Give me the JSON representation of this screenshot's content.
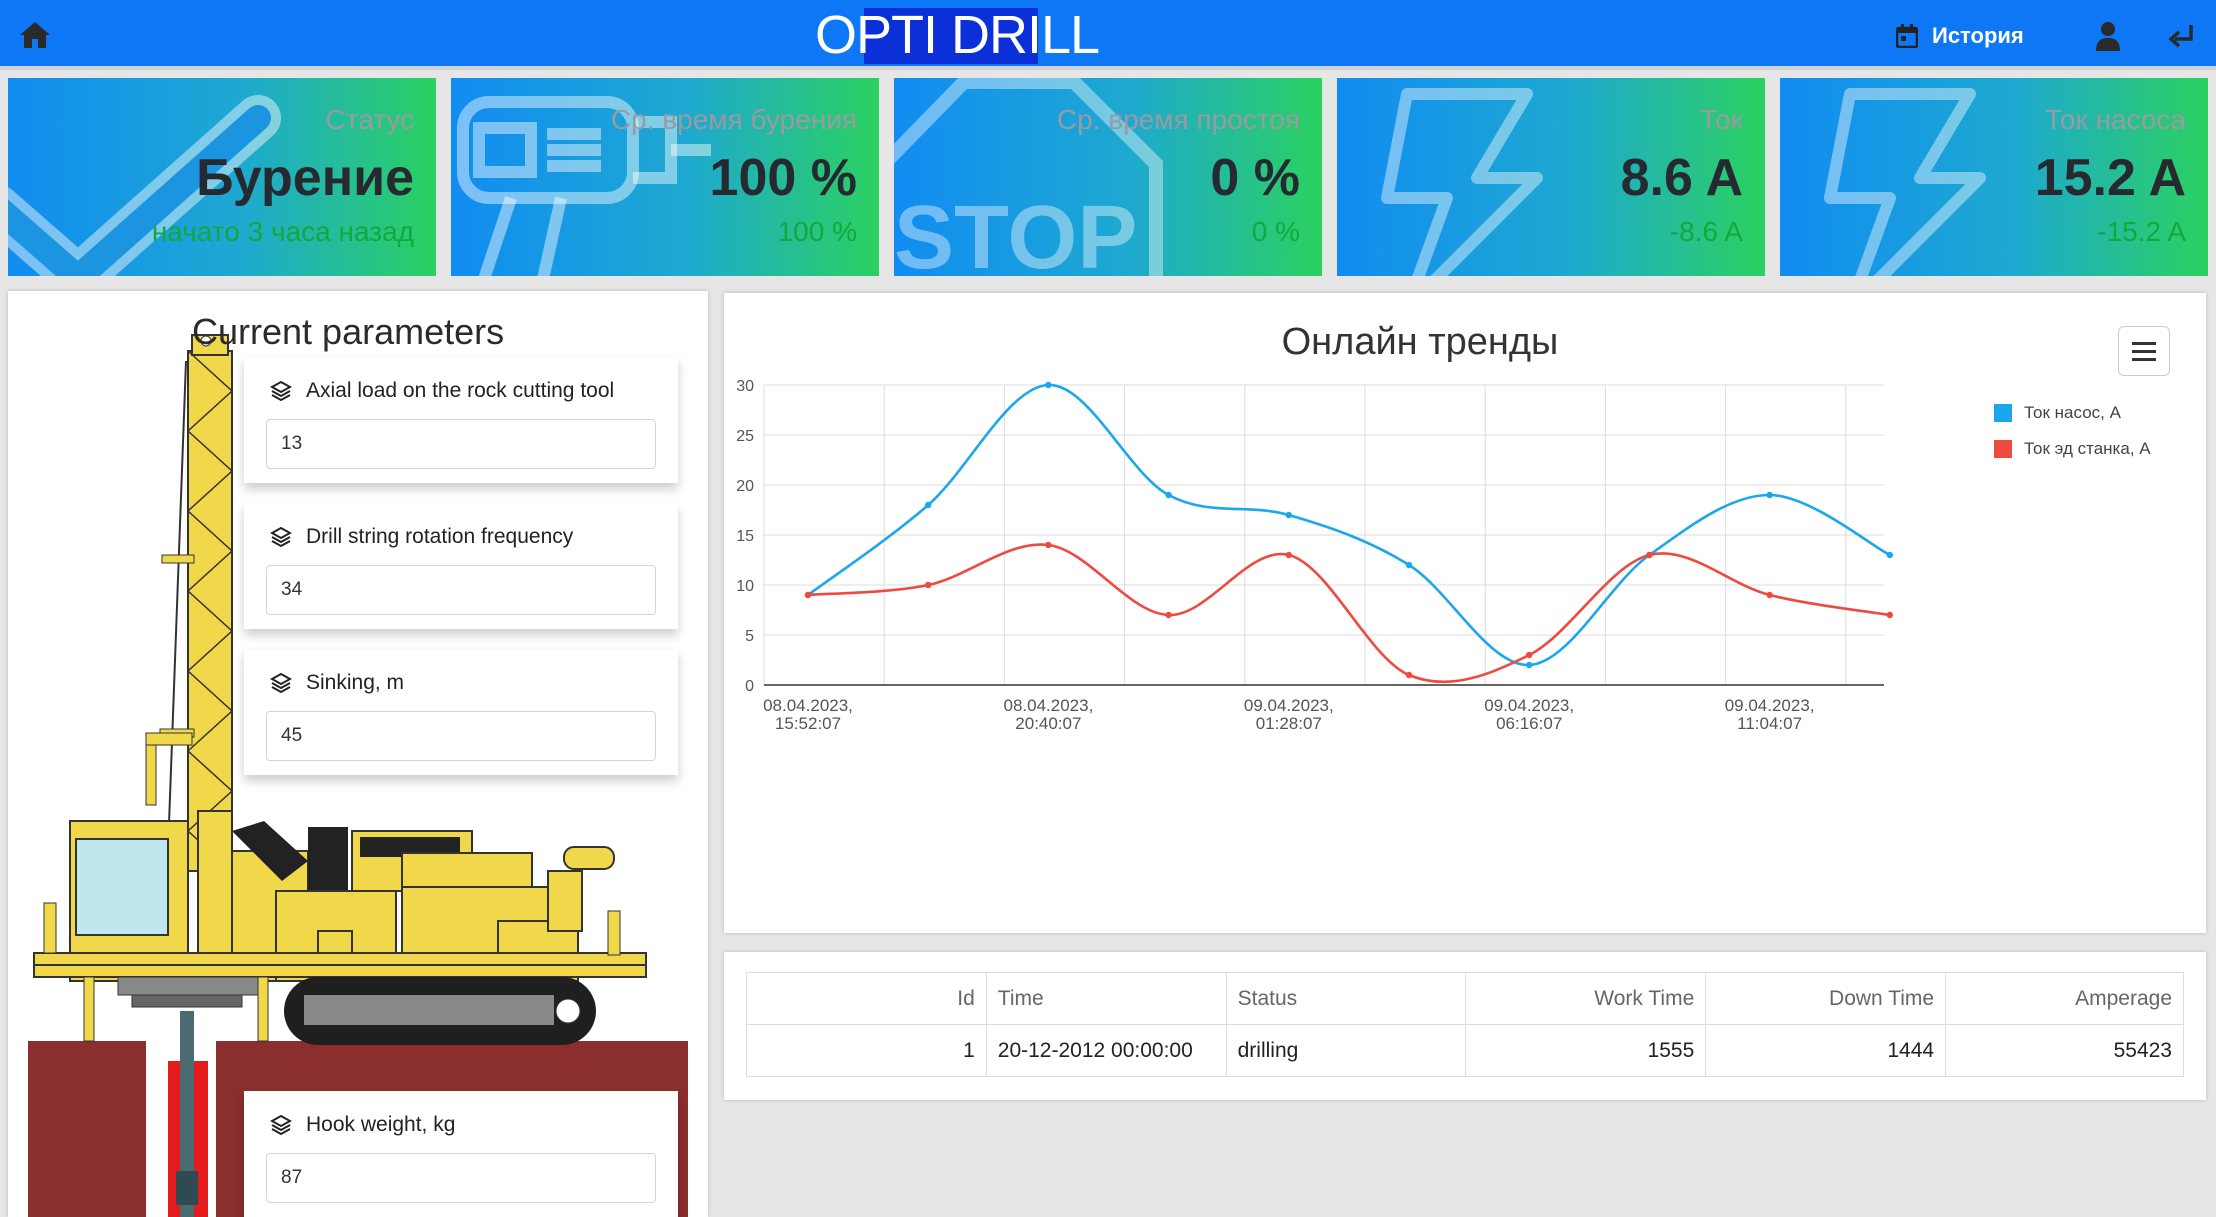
{
  "header": {
    "brand": "OPTI DRILL",
    "history_label": "История",
    "icons": {
      "home": "home-icon",
      "history": "calendar-icon",
      "user": "user-icon",
      "logout": "logout-icon"
    }
  },
  "kpis": [
    {
      "title": "Статус",
      "value": "Бурение",
      "sub": "начато 3 часа назад",
      "icon": "checkmark-icon"
    },
    {
      "title": "Ср. время бурения",
      "value": "100 %",
      "sub": "100 %",
      "icon": "drill-icon"
    },
    {
      "title": "Ср. время простоя",
      "value": "0 %",
      "sub": "0 %",
      "icon": "stop-sign-icon"
    },
    {
      "title": "Ток",
      "value": "8.6 A",
      "sub": "-8.6 A",
      "icon": "lightning-icon"
    },
    {
      "title": "Ток насоса",
      "value": "15.2 A",
      "sub": "-15.2 A",
      "icon": "lightning-icon"
    }
  ],
  "params_panel": {
    "title": "Current parameters",
    "items": [
      {
        "label": "Axial load on the rock cutting tool",
        "value": "13"
      },
      {
        "label": "Drill string rotation frequency",
        "value": "34"
      },
      {
        "label": "Sinking, m",
        "value": "45"
      },
      {
        "label": "Hook weight, kg",
        "value": "87"
      }
    ]
  },
  "trends": {
    "title": "Онлайн тренды",
    "icons": {
      "menu": "hamburger-menu-icon"
    }
  },
  "chart_data": {
    "type": "line",
    "x": [
      "08.04.2023, 15:52:07",
      "",
      "08.04.2023, 20:40:07",
      "",
      "09.04.2023, 01:28:07",
      "",
      "09.04.2023, 06:16:07",
      "",
      "09.04.2023, 11:04:07",
      ""
    ],
    "x_tick_labels": [
      [
        "08.04.2023,",
        "15:52:07"
      ],
      [
        "08.04.2023,",
        "20:40:07"
      ],
      [
        "09.04.2023,",
        "01:28:07"
      ],
      [
        "09.04.2023,",
        "06:16:07"
      ],
      [
        "09.04.2023,",
        "11:04:07"
      ]
    ],
    "series": [
      {
        "name": "Ток насос, А",
        "color": "#1aa7ec",
        "values": [
          9,
          18,
          30,
          19,
          17,
          12,
          2,
          13,
          19,
          13
        ]
      },
      {
        "name": "Ток эд станка, А",
        "color": "#ef4a3f",
        "values": [
          9,
          10,
          14,
          7,
          13,
          1,
          3,
          13,
          9,
          7
        ]
      }
    ],
    "ylim": [
      0,
      30
    ],
    "yticks": [
      0,
      5,
      10,
      15,
      20,
      25,
      30
    ],
    "grid": true,
    "legend": "right",
    "title": "Онлайн тренды",
    "xlabel": "",
    "ylabel": ""
  },
  "table": {
    "columns": [
      "Id",
      "Time",
      "Status",
      "Work Time",
      "Down Time",
      "Amperage"
    ],
    "rows": [
      [
        "1",
        "20-12-2012 00:00:00",
        "drilling",
        "1555",
        "1444",
        "55423"
      ]
    ]
  },
  "colors": {
    "header": "#0d77f5",
    "brand_highlight": "#0b30d8",
    "kpi_gradient_start": "#118cf2",
    "kpi_gradient_end": "#2bd160",
    "kpi_sub": "#14a83a"
  }
}
